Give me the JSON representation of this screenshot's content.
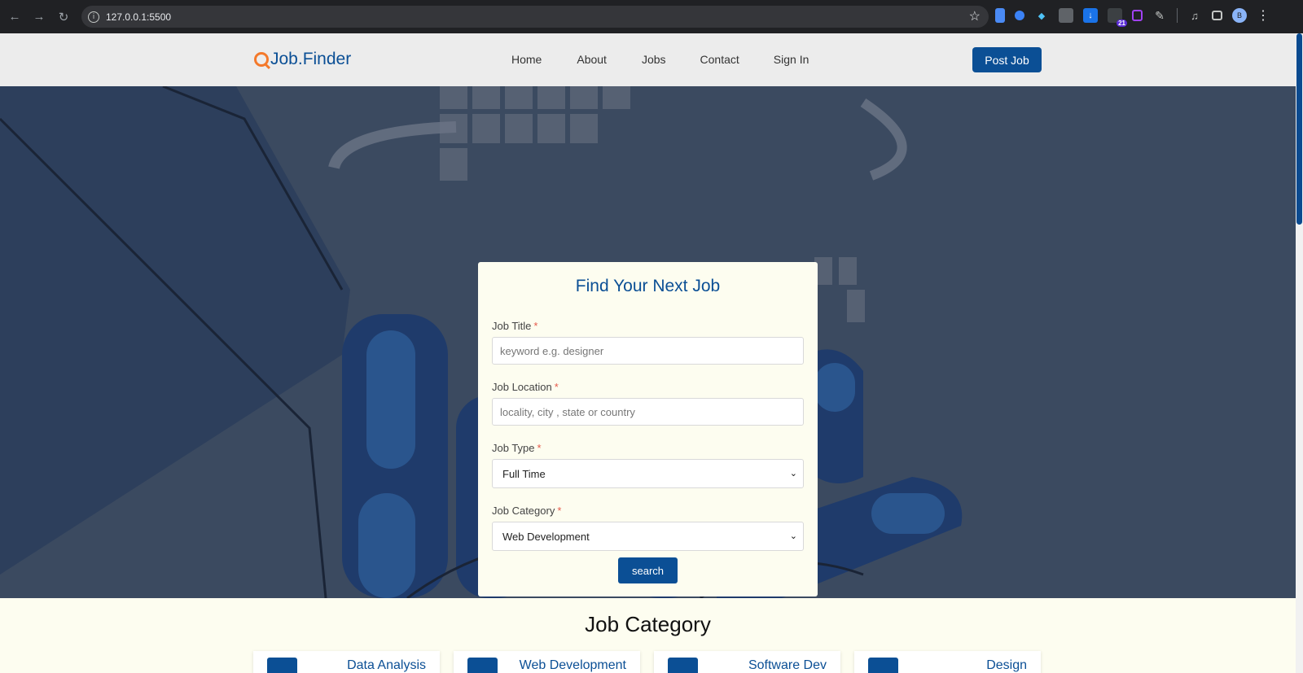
{
  "browser": {
    "url": "127.0.0.1:5500",
    "extension_badge": "21",
    "profile_initial": "B"
  },
  "header": {
    "logo": "Job.Finder",
    "nav": [
      "Home",
      "About",
      "Jobs",
      "Contact",
      "Sign In"
    ],
    "post_job_label": "Post Job"
  },
  "search_card": {
    "title": "Find Your Next Job",
    "job_title_label": "Job Title",
    "job_title_placeholder": "keyword e.g. designer",
    "job_location_label": "Job Location",
    "job_location_placeholder": "locality, city , state or country",
    "job_type_label": "Job Type",
    "job_type_value": "Full Time",
    "job_category_label": "Job Category",
    "job_category_value": "Web Development",
    "required_mark": "*",
    "search_label": "search"
  },
  "category_section": {
    "title": "Job Category",
    "cards": [
      "Data Analysis",
      "Web Development",
      "Software Dev",
      "Design"
    ]
  },
  "colors": {
    "brand": "#0b4f95",
    "logo_accent": "#f4792b",
    "required": "#e65a4b"
  }
}
